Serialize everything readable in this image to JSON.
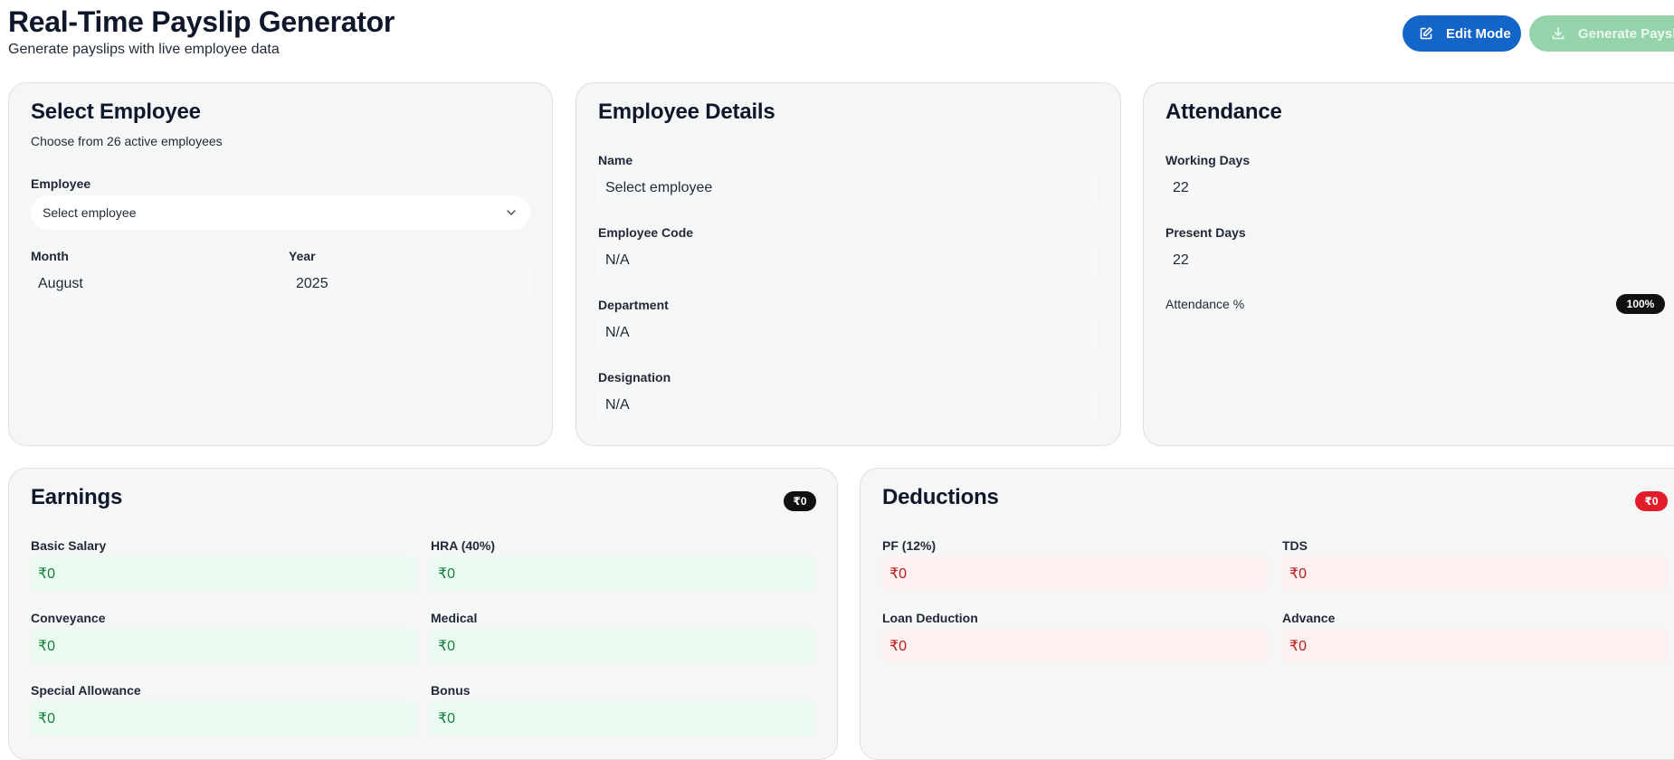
{
  "header": {
    "title": "Real-Time Payslip Generator",
    "subtitle": "Generate payslips with live employee data",
    "edit_mode_label": "Edit Mode",
    "generate_label": "Generate Payslip"
  },
  "select_employee": {
    "title": "Select Employee",
    "subtitle": "Choose from 26 active employees",
    "employee_label": "Employee",
    "employee_value": "Select employee",
    "month_label": "Month",
    "month_value": "August",
    "year_label": "Year",
    "year_value": "2025"
  },
  "employee_details": {
    "title": "Employee Details",
    "name_label": "Name",
    "name_value": "Select employee",
    "code_label": "Employee Code",
    "code_value": "N/A",
    "department_label": "Department",
    "department_value": "N/A",
    "designation_label": "Designation",
    "designation_value": "N/A"
  },
  "attendance": {
    "title": "Attendance",
    "working_days_label": "Working Days",
    "working_days_value": "22",
    "present_days_label": "Present Days",
    "present_days_value": "22",
    "percent_label": "Attendance %",
    "percent_value": "100%"
  },
  "earnings": {
    "title": "Earnings",
    "total": "₹0",
    "items": [
      {
        "label": "Basic Salary",
        "value": "₹0"
      },
      {
        "label": "HRA (40%)",
        "value": "₹0"
      },
      {
        "label": "Conveyance",
        "value": "₹0"
      },
      {
        "label": "Medical",
        "value": "₹0"
      },
      {
        "label": "Special Allowance",
        "value": "₹0"
      },
      {
        "label": "Bonus",
        "value": "₹0"
      }
    ]
  },
  "deductions": {
    "title": "Deductions",
    "total": "₹0",
    "items": [
      {
        "label": "PF (12%)",
        "value": "₹0"
      },
      {
        "label": "TDS",
        "value": "₹0"
      },
      {
        "label": "Loan Deduction",
        "value": "₹0"
      },
      {
        "label": "Advance",
        "value": "₹0"
      }
    ]
  },
  "icons": {
    "edit": "edit-icon",
    "download": "download-icon",
    "chevron": "chevron-down-icon"
  }
}
